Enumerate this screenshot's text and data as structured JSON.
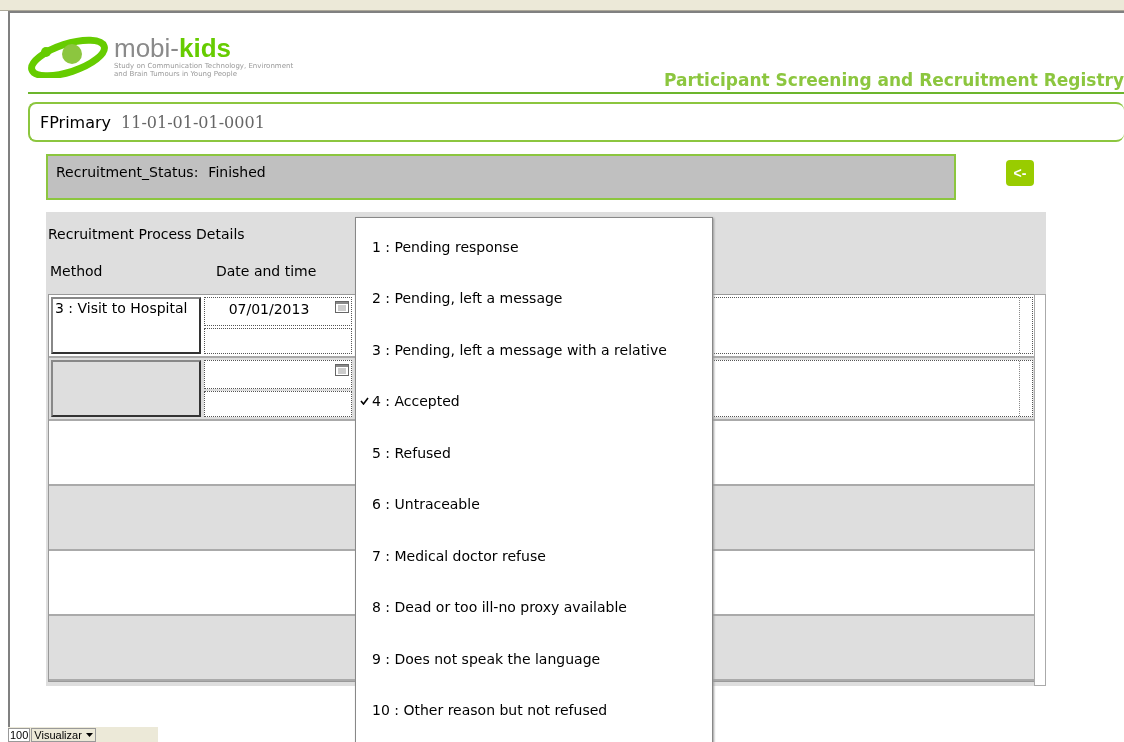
{
  "header": {
    "logo_name": "mobi-",
    "logo_accent": "kids",
    "logo_tagline": "Study on Communication Technology, Environment and Brain Tumours in Young People",
    "title": "Participant Screening and Recruitment Registry"
  },
  "primary": {
    "label": "FPrimary",
    "value": "11-01-01-01-0001"
  },
  "status": {
    "label": "Recruitment_Status:",
    "value": "Finished"
  },
  "back_button": {
    "label": "<-"
  },
  "details": {
    "title": "Recruitment Process Details",
    "columns": [
      "Method",
      "Date and time"
    ],
    "rows": [
      {
        "method": "3 : Visit to Hospital",
        "date": "07/01/2013"
      },
      {
        "method": "",
        "date": ""
      }
    ]
  },
  "dropdown": [
    {
      "label": "1 : Pending response",
      "selected": false
    },
    {
      "label": "2 : Pending, left a message",
      "selected": false
    },
    {
      "label": "3 : Pending, left a message with a relative",
      "selected": false
    },
    {
      "label": "4 : Accepted",
      "selected": true
    },
    {
      "label": "5 : Refused",
      "selected": false
    },
    {
      "label": "6 : Untraceable",
      "selected": false
    },
    {
      "label": "7 : Medical doctor refuse",
      "selected": false
    },
    {
      "label": "8 : Dead or too ill-no proxy available",
      "selected": false
    },
    {
      "label": "9 : Does not speak the language",
      "selected": false
    },
    {
      "label": "10 : Other reason but not refused",
      "selected": false
    }
  ],
  "status_bar": {
    "zoom": "100",
    "view": "Visualizar"
  }
}
